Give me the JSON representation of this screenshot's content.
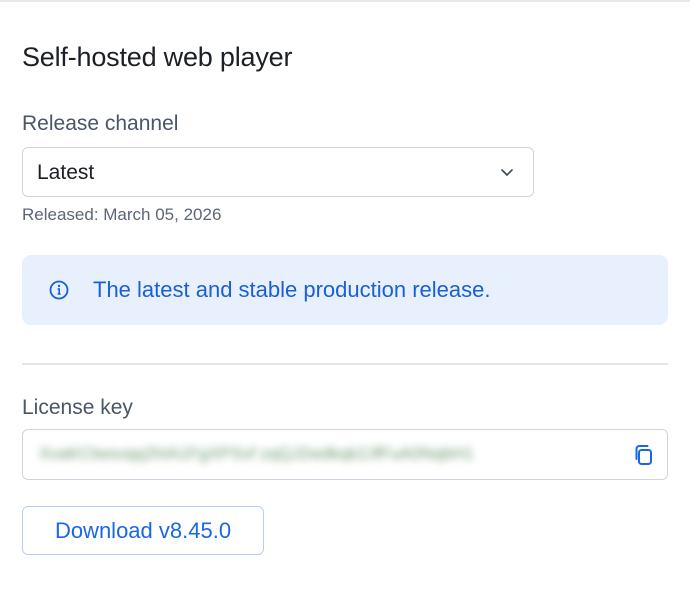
{
  "title": "Self-hosted web player",
  "release_channel": {
    "label": "Release channel",
    "selected": "Latest",
    "released_text": "Released: March 05, 2026"
  },
  "info": {
    "icon": "info-icon",
    "message": "The latest and stable production release."
  },
  "license": {
    "label": "License key",
    "value": "XvaKClwsvqq2hIA1FgXPSvf zqQJ2wdkqk2JfFuA0NqbH1",
    "copy_icon": "copy-icon"
  },
  "download_button": "Download v8.45.0",
  "colors": {
    "accent": "#1a66e8",
    "info_bg": "#e8f0fd"
  }
}
